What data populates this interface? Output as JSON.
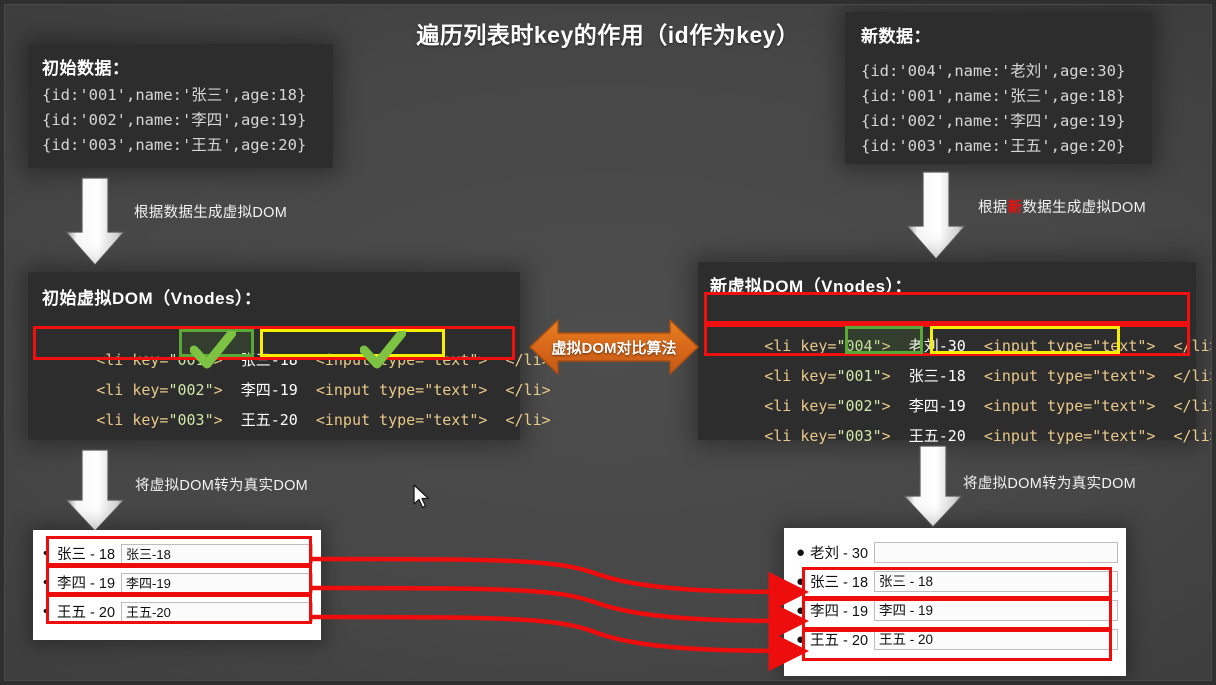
{
  "title": "遍历列表时key的作用（id作为key）",
  "colors": {
    "bg": "#434343",
    "panel_bg": "#2d2d2d",
    "highlight_red": "#f01010",
    "highlight_green": "#5aa838",
    "highlight_yellow": "#f6f000",
    "diff_arrow_orange": "#e0701a",
    "connector_red": "#ee0d0d",
    "red_char": "#e81010"
  },
  "data_initial": {
    "title": "初始数据：",
    "lines": [
      "{id:'001',name:'张三',age:18}",
      "{id:'002',name:'李四',age:19}",
      "{id:'003',name:'王五',age:20}"
    ]
  },
  "data_new": {
    "title": "新数据：",
    "lines": [
      "{id:'004',name:'老刘',age:30}",
      "{id:'001',name:'张三',age:18}",
      "{id:'002',name:'李四',age:19}",
      "{id:'003',name:'王五',age:20}"
    ]
  },
  "arrow_labels": {
    "left_top": "根据数据生成虚拟DOM",
    "right_top_prefix": "根据",
    "right_top_red": "新",
    "right_top_suffix": "数据生成虚拟DOM",
    "left_bottom": "将虚拟DOM转为真实DOM",
    "right_bottom": "将虚拟DOM转为真实DOM"
  },
  "vnodes_initial": {
    "title": "初始虚拟DOM（Vnodes）：",
    "lines": [
      {
        "key": "001",
        "text": "张三-18",
        "input": "<input type=\"text\">"
      },
      {
        "key": "002",
        "text": "李四-19",
        "input": "<input type=\"text\">"
      },
      {
        "key": "003",
        "text": "王五-20",
        "input": "<input type=\"text\">"
      }
    ],
    "open_prefix": "<li key=\"",
    "open_suffix": "\">",
    "close": "</li>"
  },
  "vnodes_new": {
    "title": "新虚拟DOM（Vnodes）：",
    "lines": [
      {
        "key": "004",
        "text": "老刘-30",
        "input": "<input type=\"text\">"
      },
      {
        "key": "001",
        "text": "张三-18",
        "input": "<input type=\"text\">"
      },
      {
        "key": "002",
        "text": "李四-19",
        "input": "<input type=\"text\">"
      },
      {
        "key": "003",
        "text": "王五-20",
        "input": "<input type=\"text\">"
      }
    ],
    "open_prefix": "<li key=\"",
    "open_suffix": "\">",
    "close": "</li>"
  },
  "diff_arrow": {
    "label": "虚拟DOM对比算法"
  },
  "real_left": {
    "rows": [
      {
        "label": "张三 - 18",
        "input_value": "张三-18"
      },
      {
        "label": "李四 - 19",
        "input_value": "李四-19"
      },
      {
        "label": "王五 - 20",
        "input_value": "王五-20"
      }
    ]
  },
  "real_right": {
    "rows": [
      {
        "label": "老刘 - 30",
        "input_value": ""
      },
      {
        "label": "张三 - 18",
        "input_value": "张三 - 18"
      },
      {
        "label": "李四 - 19",
        "input_value": "李四 - 19"
      },
      {
        "label": "王五 - 20",
        "input_value": "王五 - 20"
      }
    ]
  }
}
